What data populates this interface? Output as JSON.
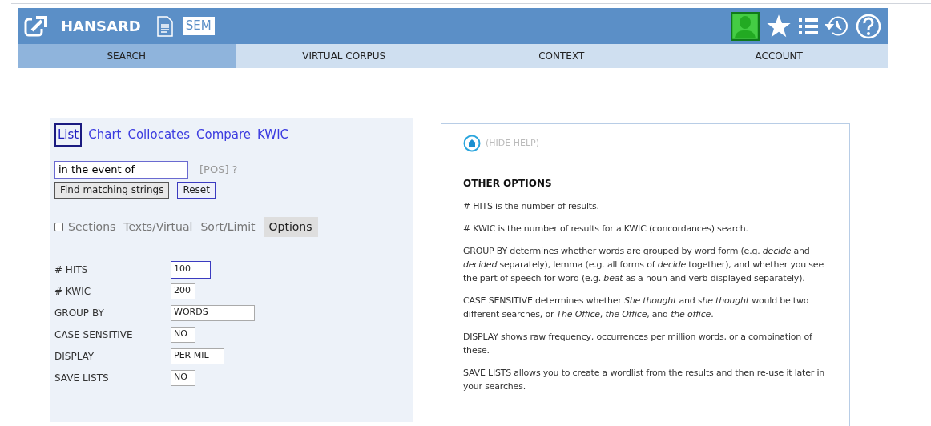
{
  "header": {
    "title": "HANSARD",
    "badge": "SEM"
  },
  "nav_tabs": [
    {
      "label": "SEARCH",
      "selected": true
    },
    {
      "label": "VIRTUAL CORPUS",
      "selected": false
    },
    {
      "label": "CONTEXT",
      "selected": false
    },
    {
      "label": "ACCOUNT",
      "selected": false
    }
  ],
  "search_modes": [
    {
      "label": "List",
      "selected": true
    },
    {
      "label": "Chart",
      "selected": false
    },
    {
      "label": "Collocates",
      "selected": false
    },
    {
      "label": "Compare",
      "selected": false
    },
    {
      "label": "KWIC",
      "selected": false
    }
  ],
  "search": {
    "value": "in the event of",
    "pos_link": "[POS]",
    "help_link": "?"
  },
  "buttons": [
    {
      "label": "Find matching strings",
      "kind": "primary"
    },
    {
      "label": "Reset",
      "kind": "secondary"
    }
  ],
  "section_tabs": [
    {
      "label": "Sections",
      "kind": "checkbox",
      "checked": false,
      "selected": false
    },
    {
      "label": "Texts/Virtual",
      "kind": "tab",
      "selected": false
    },
    {
      "label": "Sort/Limit",
      "kind": "tab",
      "selected": false
    },
    {
      "label": "Options",
      "kind": "tab",
      "selected": true
    }
  ],
  "options": [
    {
      "label": "# HITS",
      "value": "100",
      "focused": true
    },
    {
      "label": "# KWIC",
      "value": "200",
      "focused": false
    },
    {
      "label": "GROUP BY",
      "value": "WORDS",
      "focused": false
    },
    {
      "label": "CASE SENSITIVE",
      "value": "NO",
      "focused": false
    },
    {
      "label": "DISPLAY",
      "value": "PER MIL",
      "focused": false
    },
    {
      "label": "SAVE LISTS",
      "value": "NO",
      "focused": false
    }
  ],
  "help": {
    "hide_link": "(HIDE HELP)",
    "heading": "OTHER OPTIONS",
    "paragraphs": [
      "# HITS is the number of results.",
      "# KWIC is the number of results for a KWIC (concordances) search.",
      "GROUP BY determines whether words are grouped by word form (e.g. *decide* and *decided* separately), lemma (e.g. all forms of *decide* together), and whether you see the part of speech for word (e.g. *beat* as a noun and verb displayed separately).",
      "CASE SENSITIVE determines whether *She thought* and *she thought* would be two different searches, or *The Office*, *the Office*, and *the office*.",
      "DISPLAY shows raw frequency, occurrences per million words, or a combination of these.",
      "SAVE LISTS allows you to create a wordlist from the results and then re-use it later in your searches."
    ]
  }
}
